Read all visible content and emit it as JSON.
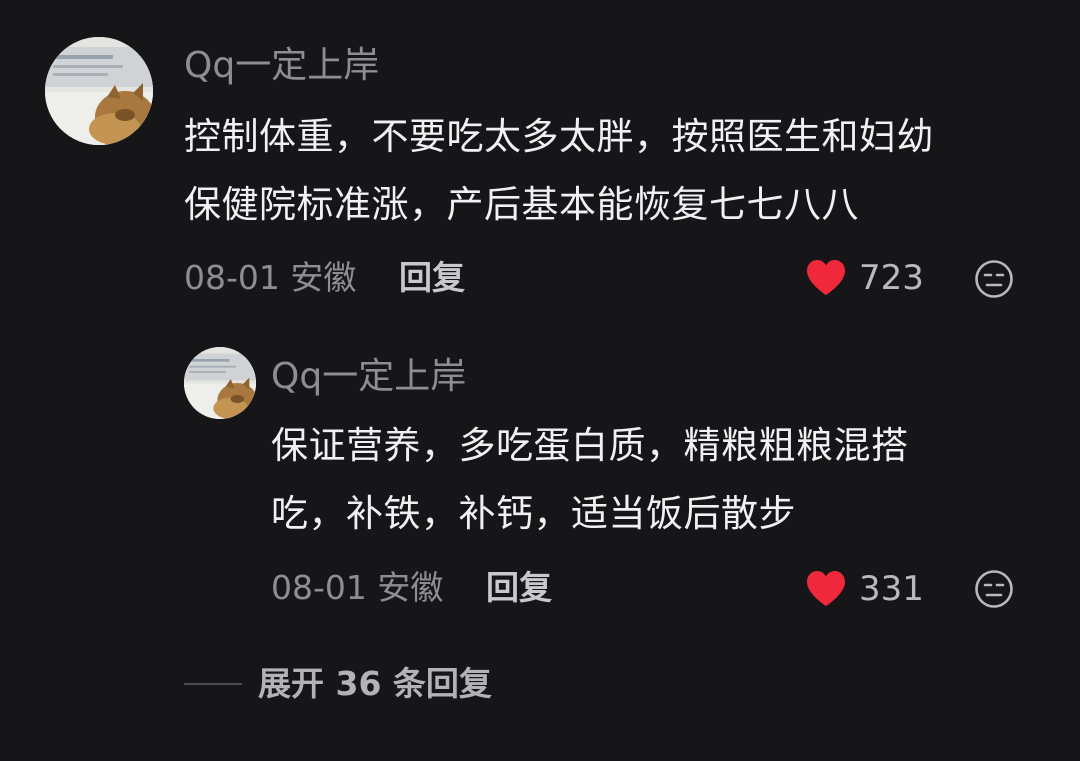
{
  "comment": {
    "username": "Qq一定上岸",
    "content_line1": "控制体重，不要吃太多太胖，按照医生和妇幼",
    "content_line2": "保健院标准涨，产后基本能恢复七七八八",
    "date": "08-01",
    "location": "安徽",
    "reply_label": "回复",
    "likes": "723",
    "avatar_icon": "cat-avatar",
    "like_icon": "heart-icon",
    "dislike_icon": "dislike-face-icon"
  },
  "reply": {
    "username": "Qq一定上岸",
    "content_line1": "保证营养，多吃蛋白质，精粮粗粮混搭",
    "content_line2": "吃，补铁，补钙，适当饭后散步",
    "date": "08-01",
    "location": "安徽",
    "reply_label": "回复",
    "likes": "331"
  },
  "expand_replies": "展开 36 条回复",
  "colors": {
    "background": "#161619",
    "heart": "#f0283c",
    "muted_text": "#8d8d93",
    "body_text": "#f1f1f3"
  }
}
